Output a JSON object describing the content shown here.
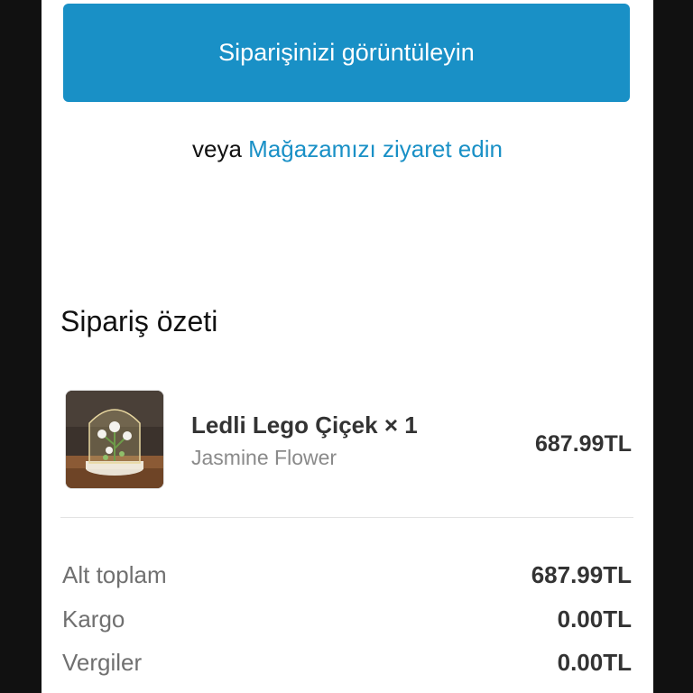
{
  "actions": {
    "view_order_label": "Siparişinizi görüntüleyin",
    "or_text": "veya",
    "visit_store_label": "Mağazamızı ziyaret edin"
  },
  "summary": {
    "title": "Sipariş özeti",
    "items": [
      {
        "name": "Ledli Lego Çiçek × 1",
        "variant": "Jasmine Flower",
        "price": "687.99TL",
        "thumbnail_icon": "flower-dome-lamp-image"
      }
    ],
    "totals": [
      {
        "label": "Alt toplam",
        "value": "687.99TL"
      },
      {
        "label": "Kargo",
        "value": "0.00TL"
      },
      {
        "label": "Vergiler",
        "value": "0.00TL"
      }
    ]
  },
  "colors": {
    "accent": "#1990c6",
    "text": "#333333",
    "muted": "#707070"
  }
}
